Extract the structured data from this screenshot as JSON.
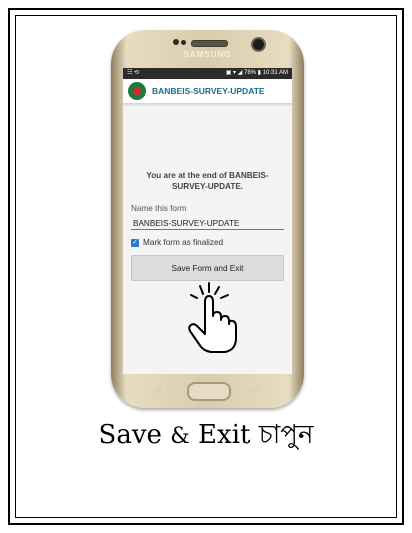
{
  "phone": {
    "brand": "SAMSUNG",
    "status_left": "☷ ⟲",
    "status_right": "▣ ▾ ◢ 78% ▮ 10:31 AM"
  },
  "app": {
    "title": "BANBEIS-SURVEY-UPDATE",
    "end_message": "You are at the end of BANBEIS-SURVEY-UPDATE.",
    "name_label": "Name this form",
    "name_value": "BANBEIS-SURVEY-UPDATE",
    "finalize_label": "Mark form as finalized",
    "save_button": "Save Form and Exit"
  },
  "caption": {
    "part1": "Save",
    "amp": "&",
    "part2": "Exit",
    "bangla": "চাপুন"
  },
  "colors": {
    "title": "#1e6c8a",
    "checkbox": "#2a78c8",
    "phone_body": "#d9ccae"
  }
}
